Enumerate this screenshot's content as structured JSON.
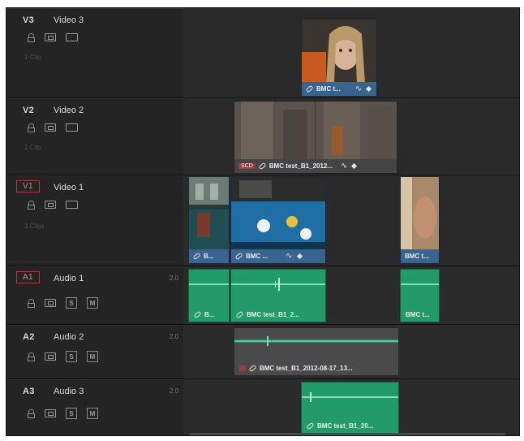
{
  "tracks": [
    {
      "id": "V3",
      "name": "Video 3",
      "clips": "1 Clip",
      "level": ""
    },
    {
      "id": "V2",
      "name": "Video 2",
      "clips": "1 Clip",
      "level": ""
    },
    {
      "id": "V1",
      "name": "Video 1",
      "clips": "3 Clips",
      "level": ""
    },
    {
      "id": "A1",
      "name": "Audio 1",
      "clips": "",
      "level": "2.0"
    },
    {
      "id": "A2",
      "name": "Audio 2",
      "clips": "",
      "level": "2.0"
    },
    {
      "id": "A3",
      "name": "Audio 3",
      "clips": "",
      "level": "2.0"
    }
  ],
  "buttons": {
    "solo": "S",
    "mute": "M"
  },
  "clips": {
    "v3_clip": "BMC t...",
    "v2_clip": "BMC test_B1_2012...",
    "v2_badge": "SCD",
    "v1_clip_a": "B...",
    "v1_clip_b": "BMC ...",
    "v1_clip_c": "BMC t...",
    "a1_clip_a": "B...",
    "a1_clip_b": "BMC test_B1_2...",
    "a1_clip_c": "BMC t...",
    "a2_clip": "BMC test_B1_2012-08-17_13...",
    "a3_clip": "BMC test_B1_20..."
  },
  "colors": {
    "video_clip": "#39648f",
    "audio_clip": "#229a69",
    "track_bg": "#242424",
    "active_outline": "#b13a3a"
  }
}
